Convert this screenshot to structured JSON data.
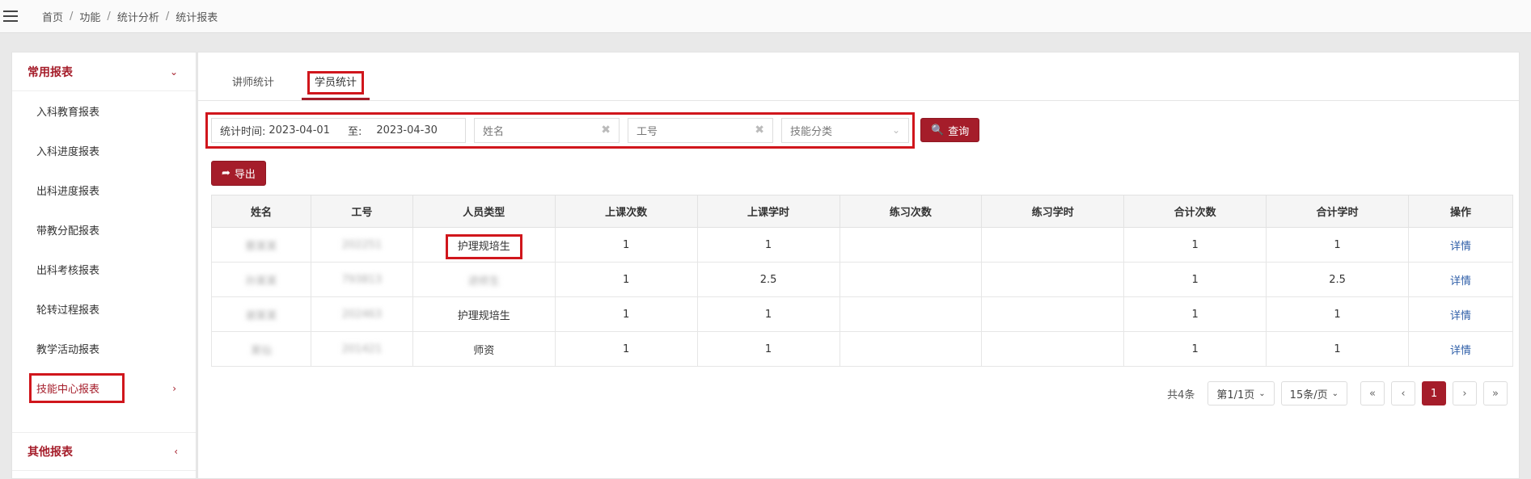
{
  "breadcrumb": [
    "首页",
    "功能",
    "统计分析",
    "统计报表"
  ],
  "sidebar": {
    "group1": "常用报表",
    "items": [
      "入科教育报表",
      "入科进度报表",
      "出科进度报表",
      "带教分配报表",
      "出科考核报表",
      "轮转过程报表",
      "教学活动报表",
      "技能中心报表"
    ],
    "group2": "其他报表"
  },
  "tabs": [
    "讲师统计",
    "学员统计"
  ],
  "filter": {
    "time_label": "统计时间:",
    "start": "2023-04-01",
    "to": "至:",
    "end": "2023-04-30",
    "name_placeholder": "姓名",
    "id_placeholder": "工号",
    "skill_placeholder": "技能分类",
    "query": "查询"
  },
  "export": "导出",
  "table": {
    "headers": [
      "姓名",
      "工号",
      "人员类型",
      "上课次数",
      "上课学时",
      "练习次数",
      "练习学时",
      "合计次数",
      "合计学时",
      "操作"
    ],
    "rows": [
      {
        "name": "蔡某某",
        "id": "202251",
        "type": "护理规培生",
        "c1": "1",
        "h1": "1",
        "c2": "",
        "h2": "",
        "c3": "1",
        "h3": "1",
        "op": "详情"
      },
      {
        "name": "孙某某",
        "id": "793813",
        "type": "进修生",
        "c1": "1",
        "h1": "2.5",
        "c2": "",
        "h2": "",
        "c3": "1",
        "h3": "2.5",
        "op": "详情"
      },
      {
        "name": "谢某某",
        "id": "202463",
        "type": "护理规培生",
        "c1": "1",
        "h1": "1",
        "c2": "",
        "h2": "",
        "c3": "1",
        "h3": "1",
        "op": "详情"
      },
      {
        "name": "某仙",
        "id": "201421",
        "type": "师资",
        "c1": "1",
        "h1": "1",
        "c2": "",
        "h2": "",
        "c3": "1",
        "h3": "1",
        "op": "详情"
      }
    ]
  },
  "pager": {
    "total": "共4条",
    "page_select": "第1/1页",
    "size_select": "15条/页",
    "first": "«",
    "prev": "‹",
    "current": "1",
    "next": "›",
    "last": "»"
  },
  "colors": {
    "brand": "#a51d2a",
    "highlight": "#d0161c",
    "link": "#2f5fa8"
  }
}
